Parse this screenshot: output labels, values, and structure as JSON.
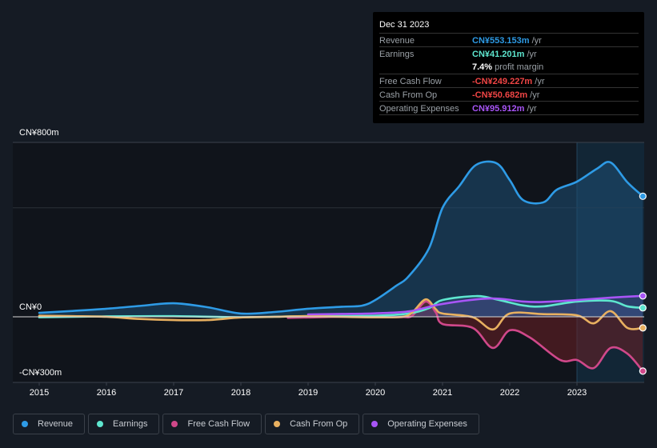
{
  "tooltip": {
    "date": "Dec 31 2023",
    "rows": [
      {
        "label": "Revenue",
        "value": "CN¥553.153m",
        "unit": " /yr",
        "color": "#2e9be6"
      },
      {
        "label": "Earnings",
        "value": "CN¥41.201m",
        "unit": " /yr",
        "color": "#5ee6cf"
      },
      {
        "label": "",
        "value": "7.4%",
        "unit": " profit margin",
        "color": "#ffffff"
      },
      {
        "label": "Free Cash Flow",
        "value": "-CN¥249.227m",
        "unit": " /yr",
        "color": "#f04545"
      },
      {
        "label": "Cash From Op",
        "value": "-CN¥50.682m",
        "unit": " /yr",
        "color": "#f04545"
      },
      {
        "label": "Operating Expenses",
        "value": "CN¥95.912m",
        "unit": " /yr",
        "color": "#a855f7"
      }
    ]
  },
  "legend": [
    {
      "label": "Revenue",
      "color": "#2e9be6"
    },
    {
      "label": "Earnings",
      "color": "#5ee6cf"
    },
    {
      "label": "Free Cash Flow",
      "color": "#d0488a"
    },
    {
      "label": "Cash From Op",
      "color": "#e8b060"
    },
    {
      "label": "Operating Expenses",
      "color": "#a855f7"
    }
  ],
  "chart_data": {
    "type": "line",
    "title": "",
    "xlabel": "",
    "ylabel": "",
    "y_tick_labels": [
      "CN¥800m",
      "CN¥0",
      "-CN¥300m"
    ],
    "y_ticks": [
      800,
      0,
      -300
    ],
    "ylim": [
      -300,
      800
    ],
    "xlim": [
      2014.8,
      2023.98
    ],
    "x_tick_labels": [
      "2015",
      "2016",
      "2017",
      "2018",
      "2019",
      "2020",
      "2021",
      "2022",
      "2023"
    ],
    "x_ticks": [
      2015,
      2016,
      2017,
      2018,
      2019,
      2020,
      2021,
      2022,
      2023
    ],
    "highlight_start": 2023.0,
    "units": "CN¥ millions",
    "series": [
      {
        "name": "Revenue",
        "color": "#2e9be6",
        "x": [
          2015.0,
          2015.5,
          2016.0,
          2016.5,
          2017.0,
          2017.5,
          2018.0,
          2018.5,
          2019.0,
          2019.5,
          2019.8,
          2020.0,
          2020.3,
          2020.5,
          2020.8,
          2021.0,
          2021.25,
          2021.5,
          2021.8,
          2022.0,
          2022.2,
          2022.5,
          2022.7,
          2023.0,
          2023.3,
          2023.5,
          2023.75,
          2023.98
        ],
        "y": [
          18,
          27,
          37,
          50,
          62,
          44,
          15,
          22,
          37,
          46,
          51,
          77,
          140,
          187,
          315,
          500,
          600,
          697,
          705,
          627,
          535,
          525,
          583,
          620,
          680,
          708,
          617,
          553
        ]
      },
      {
        "name": "Earnings",
        "color": "#5ee6cf",
        "x": [
          2015.0,
          2016.0,
          2017.0,
          2018.0,
          2019.0,
          2020.0,
          2020.5,
          2020.8,
          2021.0,
          2021.5,
          2021.8,
          2022.2,
          2022.5,
          2023.0,
          2023.5,
          2023.75,
          2023.98
        ],
        "y": [
          -2,
          2,
          3,
          -2,
          3,
          5,
          15,
          40,
          77,
          95,
          80,
          52,
          48,
          70,
          73,
          48,
          41
        ]
      },
      {
        "name": "Free Cash Flow",
        "color": "#d0488a",
        "x": [
          2018.7,
          2019.0,
          2019.5,
          2020.0,
          2020.4,
          2020.55,
          2020.75,
          2020.9,
          2021.0,
          2021.45,
          2021.75,
          2022.0,
          2022.3,
          2022.75,
          2023.0,
          2023.25,
          2023.5,
          2023.75,
          2023.98
        ],
        "y": [
          -5,
          -3,
          0,
          -2,
          -1,
          5,
          70,
          20,
          -33,
          -51,
          -143,
          -62,
          -95,
          -198,
          -198,
          -235,
          -143,
          -169,
          -249
        ]
      },
      {
        "name": "Cash From Op",
        "color": "#e8b060",
        "x": [
          2015.0,
          2015.5,
          2016.0,
          2016.5,
          2017.0,
          2017.5,
          2018.0,
          2018.5,
          2019.0,
          2019.5,
          2020.0,
          2020.4,
          2020.55,
          2020.75,
          2020.9,
          2021.0,
          2021.45,
          2021.75,
          2022.0,
          2022.5,
          2023.0,
          2023.25,
          2023.5,
          2023.75,
          2023.98
        ],
        "y": [
          5,
          3,
          0,
          -10,
          -15,
          -15,
          -3,
          0,
          3,
          0,
          -2,
          0,
          20,
          80,
          35,
          15,
          -2,
          -58,
          15,
          12,
          7,
          -30,
          26,
          -51,
          -51
        ]
      },
      {
        "name": "Operating Expenses",
        "color": "#a855f7",
        "x": [
          2019.0,
          2019.5,
          2020.0,
          2020.5,
          2021.0,
          2021.7,
          2022.2,
          2022.5,
          2023.0,
          2023.5,
          2023.98
        ],
        "y": [
          11,
          13,
          16,
          25,
          59,
          84,
          70,
          68,
          77,
          88,
          96
        ]
      }
    ]
  }
}
